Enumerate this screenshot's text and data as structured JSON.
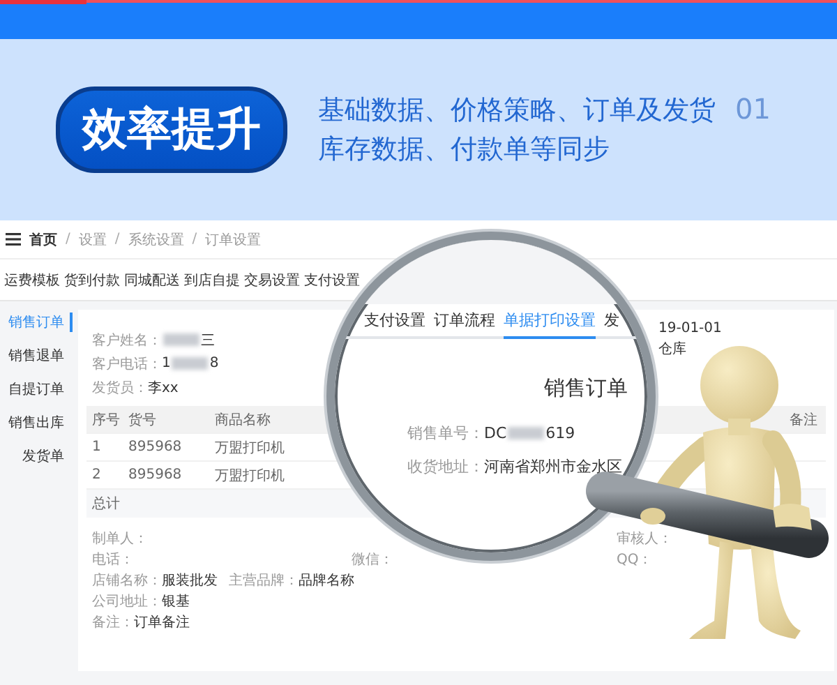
{
  "banner": {
    "badge": "效率提升",
    "lines": [
      "基础数据、价格策略、订单及发货",
      "库存数据、付款单等同步"
    ],
    "number": "01"
  },
  "app": {
    "breadcrumb": [
      "首页",
      "设置",
      "系统设置",
      "订单设置"
    ],
    "separator": "/",
    "tabs": [
      "运费模板",
      "货到付款",
      "同城配送",
      "到店自提",
      "交易设置",
      "支付设置"
    ],
    "sidebar": [
      {
        "label": "销售订单",
        "selected": true
      },
      {
        "label": "销售退单",
        "selected": false
      },
      {
        "label": "自提订单",
        "selected": false
      },
      {
        "label": "销售出库",
        "selected": false
      },
      {
        "label": "发货单",
        "selected": false
      }
    ],
    "fields": [
      {
        "label": "客户姓名：",
        "redacted": true,
        "tail": "三"
      },
      {
        "label": "客户电话：",
        "head": "1",
        "redacted": true,
        "tail": "8"
      },
      {
        "label": "发货员：",
        "redacted": false,
        "tail": "李xx"
      }
    ],
    "meta": [
      "19-01-01",
      "仓库"
    ],
    "table": {
      "columns": [
        "序号",
        "货号",
        "商品名称"
      ],
      "last_column": "备注",
      "rows": [
        [
          "1",
          "895968",
          "万盟打印机"
        ],
        [
          "2",
          "895968",
          "万盟打印机"
        ]
      ],
      "total": "总计"
    },
    "footer": {
      "grid": [
        {
          "left": "制单人：",
          "right": "审核人："
        },
        {
          "left": "电话：",
          "middle": "微信：",
          "right": "QQ："
        }
      ],
      "lines": [
        [
          {
            "label": "店铺名称：",
            "value": "服装批发"
          },
          {
            "label": "主营品牌：",
            "value": "品牌名称"
          }
        ],
        [
          {
            "label": "公司地址：",
            "value": "银基"
          }
        ],
        [
          {
            "label": "备注：",
            "value": "订单备注"
          }
        ]
      ]
    }
  },
  "lens": {
    "tabs": [
      {
        "label": "支付设置",
        "selected": false
      },
      {
        "label": "订单流程",
        "selected": false
      },
      {
        "label": "单据打印设置",
        "selected": true
      },
      {
        "label": "发",
        "selected": false
      }
    ],
    "title": "销售订单",
    "fields": [
      {
        "label": "销售单号：",
        "head": "DC",
        "redacted": true,
        "tail": "619"
      },
      {
        "label": "收货地址：",
        "redacted": false,
        "tail": "河南省郑州市金水区"
      }
    ]
  }
}
